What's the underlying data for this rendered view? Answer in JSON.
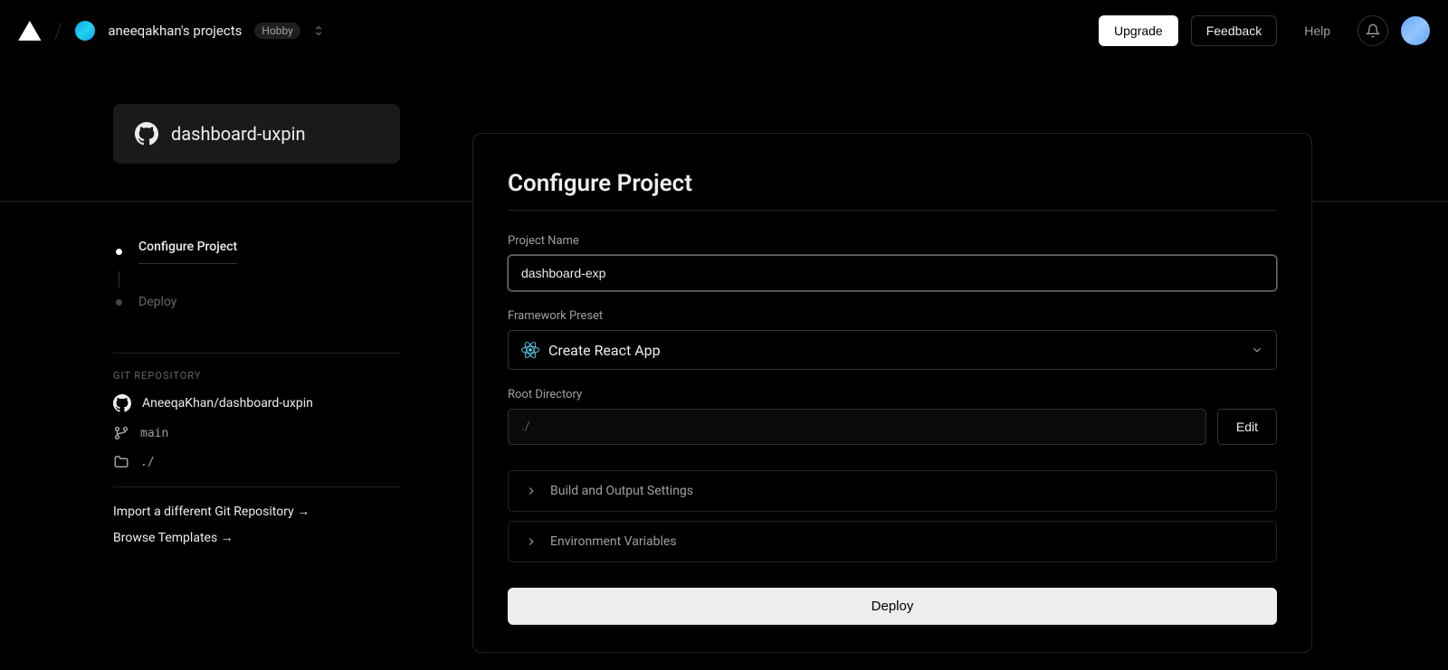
{
  "header": {
    "team_name": "aneeqakhan's projects",
    "plan_badge": "Hobby",
    "upgrade": "Upgrade",
    "feedback": "Feedback",
    "help": "Help"
  },
  "repo_card": {
    "name": "dashboard-uxpin"
  },
  "steps": {
    "configure": "Configure Project",
    "deploy": "Deploy"
  },
  "git": {
    "heading": "GIT REPOSITORY",
    "repo": "AneeqaKhan/dashboard-uxpin",
    "branch": "main",
    "dir": "./",
    "import_link": "Import a different Git Repository →",
    "browse_link": "Browse Templates →"
  },
  "form": {
    "title": "Configure Project",
    "project_name_label": "Project Name",
    "project_name_value": "dashboard-exp",
    "framework_label": "Framework Preset",
    "framework_value": "Create React App",
    "root_label": "Root Directory",
    "root_value": "./",
    "edit": "Edit",
    "build_settings": "Build and Output Settings",
    "env_vars": "Environment Variables",
    "deploy": "Deploy"
  }
}
